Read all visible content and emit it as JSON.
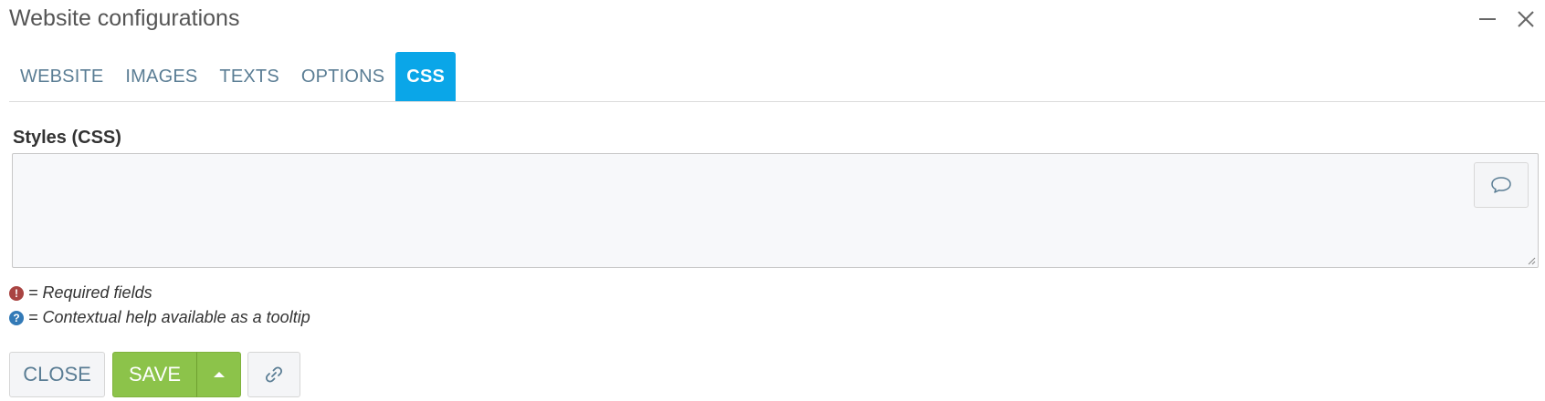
{
  "window": {
    "title": "Website configurations",
    "minimize_icon": "minimize-icon",
    "close_icon": "close-icon"
  },
  "tabs": [
    {
      "label": "WEBSITE",
      "active": false
    },
    {
      "label": "IMAGES",
      "active": false
    },
    {
      "label": "TEXTS",
      "active": false
    },
    {
      "label": "OPTIONS",
      "active": false
    },
    {
      "label": "CSS",
      "active": true
    }
  ],
  "css_field": {
    "label": "Styles (CSS)",
    "value": "",
    "comment_icon": "speech-bubble-icon"
  },
  "legend": {
    "required": {
      "icon": "exclamation-circle-icon",
      "text": "= Required fields",
      "color": "#a94442"
    },
    "help": {
      "icon": "question-circle-icon",
      "text": "= Contextual help available as a tooltip",
      "color": "#337ab7"
    }
  },
  "buttons": {
    "close_label": "CLOSE",
    "save_label": "SAVE",
    "save_menu_icon": "caret-up-icon",
    "link_icon": "link-icon"
  },
  "colors": {
    "accent_tab": "#0aa6e8",
    "save_green": "#8cc34a",
    "tab_text": "#5a7d94"
  }
}
